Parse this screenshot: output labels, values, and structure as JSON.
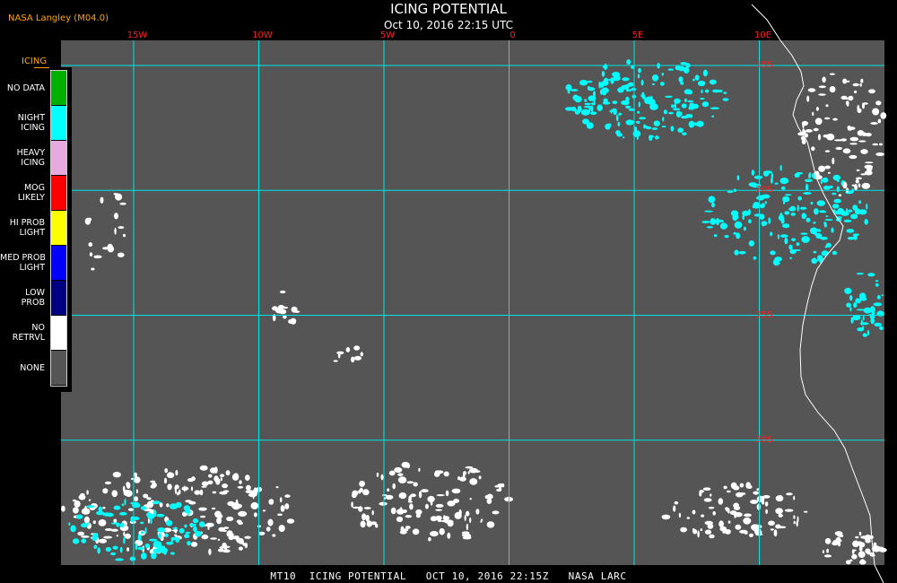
{
  "header": {
    "source_label": "NASA Langley (M04.0)",
    "title": "ICING POTENTIAL",
    "subtitle": "Oct 10, 2016 22:15 UTC"
  },
  "longitude_ticks": [
    {
      "label": "15W",
      "value": -15
    },
    {
      "label": "10W",
      "value": -10
    },
    {
      "label": "5W",
      "value": -5
    },
    {
      "label": "0",
      "value": 0
    },
    {
      "label": "5E",
      "value": 5
    },
    {
      "label": "10E",
      "value": 10
    }
  ],
  "latitude_ticks": [
    {
      "label": "15S",
      "value": -15
    },
    {
      "label": "20S",
      "value": -20
    },
    {
      "label": "25S",
      "value": -25
    },
    {
      "label": "30S",
      "value": -30
    }
  ],
  "legend": {
    "title": "ICING",
    "items": [
      {
        "label": "NO DATA",
        "color": "#00b000"
      },
      {
        "label": "NIGHT\nICING",
        "color": "#00ffff"
      },
      {
        "label": "HEAVY\nICING",
        "color": "#e8a8e0"
      },
      {
        "label": "MOG\nLIKELY",
        "color": "#ff0000"
      },
      {
        "label": "HI PROB\nLIGHT",
        "color": "#ffff00"
      },
      {
        "label": "MED PROB\nLIGHT",
        "color": "#0000ff"
      },
      {
        "label": "LOW\nPROB",
        "color": "#000080"
      },
      {
        "label": "NO\nRETRVL",
        "color": "#ffffff"
      },
      {
        "label": "NONE",
        "color": "#555555"
      }
    ]
  },
  "colors": {
    "background": "#555555",
    "gridlines": "#00e5e5",
    "night_icing": "#00ffff",
    "no_retrieval": "#ffffff",
    "coastline": "#ffffff",
    "axis_label": "#ff2020",
    "accent_text": "#ffa500"
  },
  "footer": {
    "caption": "MT10  ICING POTENTIAL   OCT 10, 2016 22:15Z   NASA LARC"
  }
}
